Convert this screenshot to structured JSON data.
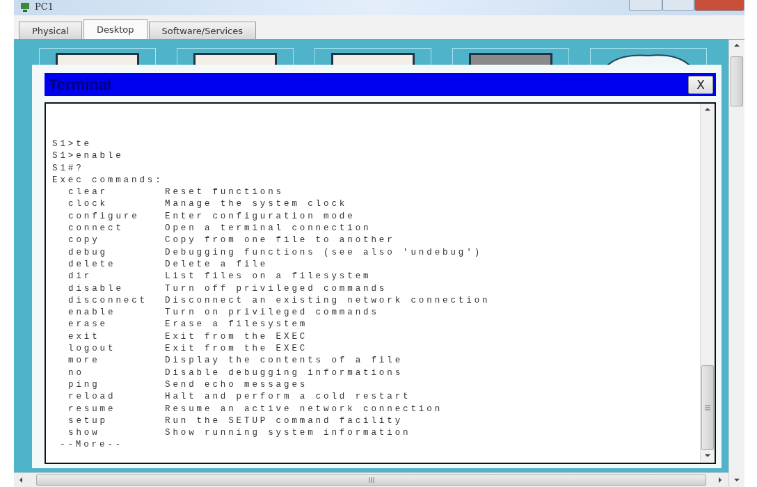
{
  "window": {
    "title": "PC1"
  },
  "tabs": [
    {
      "label": "Physical",
      "selected": false
    },
    {
      "label": "Desktop",
      "selected": true
    },
    {
      "label": "Software/Services",
      "selected": false
    }
  ],
  "terminal": {
    "title": "Terminal",
    "close": "X",
    "lines": [
      "S1>te",
      "S1>enable",
      "S1#?",
      "Exec commands:"
    ],
    "commands": [
      {
        "name": "clear",
        "description": "Reset functions"
      },
      {
        "name": "clock",
        "description": "Manage the system clock"
      },
      {
        "name": "configure",
        "description": "Enter configuration mode"
      },
      {
        "name": "connect",
        "description": "Open a terminal connection"
      },
      {
        "name": "copy",
        "description": "Copy from one file to another"
      },
      {
        "name": "debug",
        "description": "Debugging functions (see also 'undebug')"
      },
      {
        "name": "delete",
        "description": "Delete a file"
      },
      {
        "name": "dir",
        "description": "List files on a filesystem"
      },
      {
        "name": "disable",
        "description": "Turn off privileged commands"
      },
      {
        "name": "disconnect",
        "description": "Disconnect an existing network connection"
      },
      {
        "name": "enable",
        "description": "Turn on privileged commands"
      },
      {
        "name": "erase",
        "description": "Erase a filesystem"
      },
      {
        "name": "exit",
        "description": "Exit from the EXEC"
      },
      {
        "name": "logout",
        "description": "Exit from the EXEC"
      },
      {
        "name": "more",
        "description": "Display the contents of a file"
      },
      {
        "name": "no",
        "description": "Disable debugging informations"
      },
      {
        "name": "ping",
        "description": "Send echo messages"
      },
      {
        "name": "reload",
        "description": "Halt and perform a cold restart"
      },
      {
        "name": "resume",
        "description": "Resume an active network connection"
      },
      {
        "name": "setup",
        "description": "Run the SETUP command facility"
      },
      {
        "name": "show",
        "description": "Show running system information"
      }
    ],
    "more": "--More--"
  }
}
